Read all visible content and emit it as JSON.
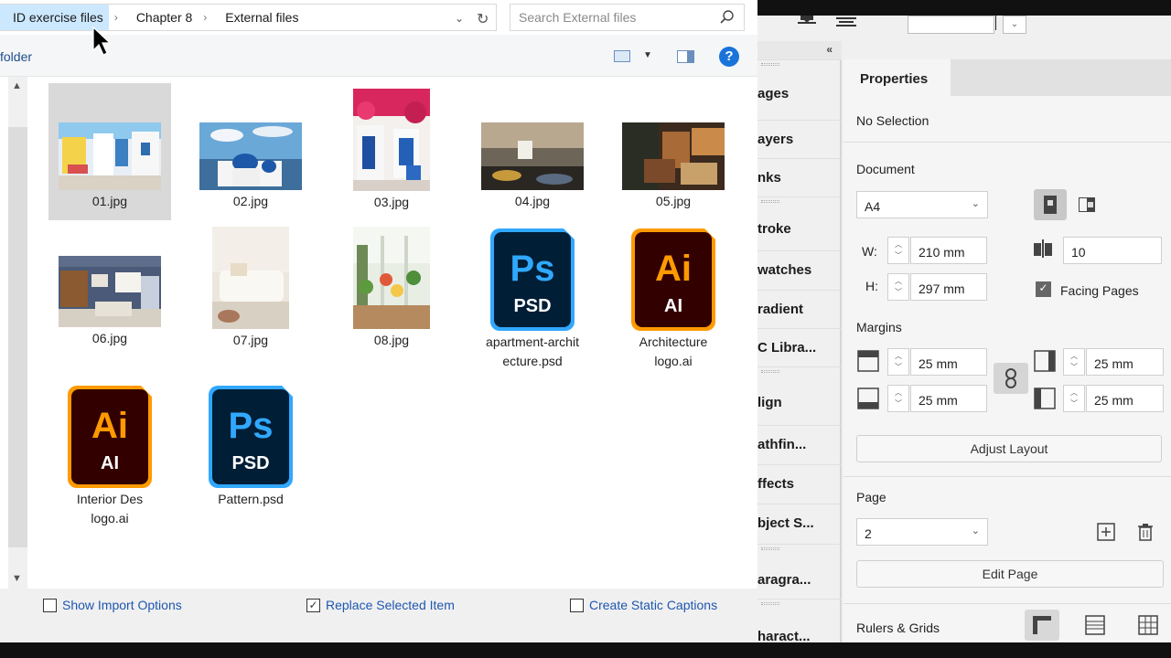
{
  "dialog": {
    "breadcrumb": [
      "ID exercise files",
      "Chapter 8",
      "External files"
    ],
    "search_placeholder": "Search External files",
    "folder_label": "folder",
    "help_label": "?",
    "files": [
      {
        "name": "01.jpg",
        "kind": "image",
        "selected": true
      },
      {
        "name": "02.jpg",
        "kind": "image"
      },
      {
        "name": "03.jpg",
        "kind": "image"
      },
      {
        "name": "04.jpg",
        "kind": "image"
      },
      {
        "name": "05.jpg",
        "kind": "image"
      },
      {
        "name": "06.jpg",
        "kind": "image"
      },
      {
        "name": "07.jpg",
        "kind": "image"
      },
      {
        "name": "08.jpg",
        "kind": "image"
      },
      {
        "name": "apartment-archit ecture.psd",
        "kind": "psd",
        "line1": "apartment-archit",
        "line2": "ecture.psd"
      },
      {
        "name": "Architecture logo.ai",
        "kind": "ai",
        "line1": "Architecture",
        "line2": "logo.ai"
      },
      {
        "name": "Interior Des logo.ai",
        "kind": "ai",
        "line1": "Interior Des",
        "line2": "logo.ai"
      },
      {
        "name": "Pattern.psd",
        "kind": "psd",
        "line1": "Pattern.psd",
        "line2": ""
      }
    ],
    "ai_icon": {
      "big": "Ai",
      "small": "AI"
    },
    "ps_icon": {
      "big": "Ps",
      "small": "PSD"
    },
    "options": {
      "show_import": {
        "label": "Show Import Options",
        "checked": false
      },
      "replace_selected": {
        "label": "Replace Selected Item",
        "checked": true
      },
      "static_captions": {
        "label": "Create Static Captions",
        "checked": false
      }
    }
  },
  "dock": {
    "collapse_label": "«",
    "items": [
      "ages",
      "ayers",
      "nks",
      "troke",
      "watches",
      "radient",
      "C Libra...",
      "lign",
      "athfin...",
      "ffects",
      "bject S...",
      "aragra...",
      "haract..."
    ]
  },
  "properties": {
    "tab": "Properties",
    "selection": "No Selection",
    "document_heading": "Document",
    "page_size": "A4",
    "width_label": "W:",
    "width": "210 mm",
    "height_label": "H:",
    "height": "297 mm",
    "pages": "10",
    "facing_pages": {
      "label": "Facing Pages",
      "checked": true
    },
    "margins_heading": "Margins",
    "margin_top": "25 mm",
    "margin_bottom": "25 mm",
    "margin_left": "25 mm",
    "margin_right": "25 mm",
    "adjust_layout": "Adjust Layout",
    "page_heading": "Page",
    "page_value": "2",
    "edit_page": "Edit Page",
    "rulers_heading": "Rulers & Grids"
  },
  "colors": {
    "accent": "#1e56b0",
    "ai_orange": "#ff9a00",
    "ai_bg": "#330000",
    "ps_blue": "#31a8ff",
    "ps_bg": "#001e36"
  }
}
